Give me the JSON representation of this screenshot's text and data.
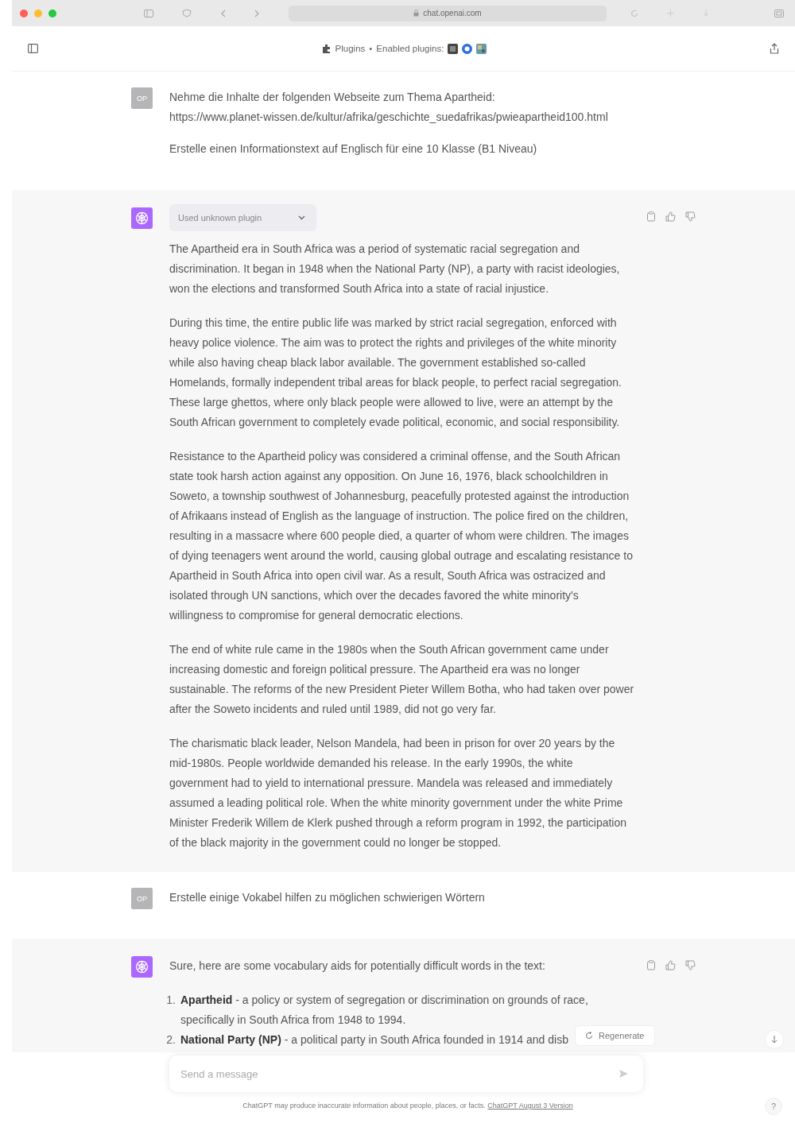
{
  "browser": {
    "url": "chat.openai.com"
  },
  "header": {
    "plugins_label": "Plugins",
    "separator": "•",
    "enabled_label": "Enabled plugins:"
  },
  "messages": [
    {
      "kind": "user",
      "avatar": "OP",
      "paragraphs": [
        "Nehme die Inhalte der folgenden Webseite zum Thema Apartheid:\nhttps://www.planet-wissen.de/kultur/afrika/geschichte_suedafrikas/pwieapartheid100.html",
        "Erstelle einen Informationstext auf Englisch für eine 10 Klasse (B1 Niveau)"
      ]
    },
    {
      "kind": "assistant",
      "plugin_badge": "Used unknown plugin",
      "paragraphs": [
        "The Apartheid era in South Africa was a period of systematic racial segregation and discrimination. It began in 1948 when the National Party (NP), a party with racist ideologies, won the elections and transformed South Africa into a state of racial injustice.",
        "During this time, the entire public life was marked by strict racial segregation, enforced with heavy police violence. The aim was to protect the rights and privileges of the white minority while also having cheap black labor available. The government established so-called Homelands, formally independent tribal areas for black people, to perfect racial segregation. These large ghettos, where only black people were allowed to live, were an attempt by the South African government to completely evade political, economic, and social responsibility.",
        "Resistance to the Apartheid policy was considered a criminal offense, and the South African state took harsh action against any opposition. On June 16, 1976, black schoolchildren in Soweto, a township southwest of Johannesburg, peacefully protested against the introduction of Afrikaans instead of English as the language of instruction. The police fired on the children, resulting in a massacre where 600 people died, a quarter of whom were children. The images of dying teenagers went around the world, causing global outrage and escalating resistance to Apartheid in South Africa into open civil war. As a result, South Africa was ostracized and isolated through UN sanctions, which over the decades favored the white minority's willingness to compromise for general democratic elections.",
        "The end of white rule came in the 1980s when the South African government came under increasing domestic and foreign political pressure. The Apartheid era was no longer sustainable. The reforms of the new President Pieter Willem Botha, who had taken over power after the Soweto incidents and ruled until 1989, did not go very far.",
        "The charismatic black leader, Nelson Mandela, had been in prison for over 20 years by the mid-1980s. People worldwide demanded his release. In the early 1990s, the white government had to yield to international pressure. Mandela was released and immediately assumed a leading political role. When the white minority government under the white Prime Minister Frederik Willem de Klerk pushed through a reform program in 1992, the participation of the black majority in the government could no longer be stopped."
      ]
    },
    {
      "kind": "user",
      "avatar": "OP",
      "paragraphs": [
        "Erstelle einige Vokabel hilfen zu möglichen schwierigen Wörtern"
      ]
    },
    {
      "kind": "assistant",
      "paragraphs": [
        "Sure, here are some vocabulary aids for potentially difficult words in the text:"
      ],
      "list": [
        {
          "number": "1.",
          "term": "Apartheid",
          "definition": "- a policy or system of segregation or discrimination on grounds of race, specifically in South Africa from 1948 to 1994."
        },
        {
          "number": "2.",
          "term": "National Party (NP)",
          "definition": "- a political party in South Africa founded in 1914 and disb"
        }
      ]
    }
  ],
  "regenerate_button": "Regenerate",
  "composer": {
    "placeholder": "Send a message"
  },
  "footer": {
    "disclaimer": "ChatGPT may produce inaccurate information about people, places, or facts.",
    "link": "ChatGPT August 3 Version"
  },
  "help_button": "?"
}
